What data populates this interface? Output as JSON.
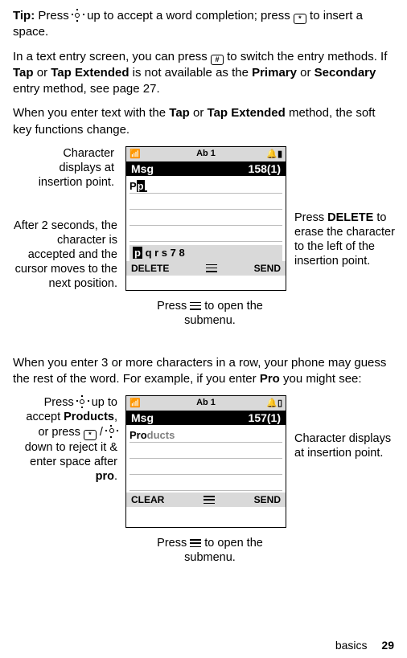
{
  "tip_label": "Tip:",
  "para1_a": "Press ",
  "para1_b": " up to accept a word completion; press ",
  "para1_c": " to insert a space.",
  "para2_a": "In a text entry screen, you can press ",
  "para2_b": " to switch the entry methods. If ",
  "tap": "Tap",
  "tap_ext": "Tap Extended",
  "para2_c": " is not available as the ",
  "primary": "Primary",
  "para2_d": " or ",
  "secondary": "Secondary",
  "para2_e": " entry method, see page 27.",
  "para3_a": "When you enter text with the ",
  "para3_b": " or ",
  "para3_c": " method, the soft key functions change.",
  "para4_a": "When you enter 3 or more characters in a row, your phone may guess the rest of the word. For example, if you enter ",
  "pro": "Pro",
  "para4_b": " you might see:",
  "fig1": {
    "status_mode": "Ab 1",
    "title": "Msg",
    "count": "158(1)",
    "typed": "P",
    "pending": "p",
    "candidates": "pq r s 7 8",
    "left_softkey": "DELETE",
    "right_softkey": "SEND",
    "callout_tl": "Character displays at insertion point.",
    "callout_bl": "After 2 seconds, the character is accepted and the cursor moves to the next position.",
    "callout_r_a": "Press ",
    "callout_r_b": "DELETE",
    "callout_r_c": " to erase the character to the left of the insertion point.",
    "callout_bottom_a": "Press ",
    "callout_bottom_b": " to open the submenu."
  },
  "fig2": {
    "status_mode": "Ab 1",
    "title": "Msg",
    "count": "157(1)",
    "typed": "Pro",
    "suggested": "ducts",
    "left_softkey": "CLEAR",
    "right_softkey": "SEND",
    "callout_l_a": "Press ",
    "callout_l_b": " up to accept ",
    "products": "Products",
    "callout_l_c": ", or press ",
    "callout_l_d": " / ",
    "callout_l_e": " down to reject it & enter space after ",
    "pro_lower": "pro",
    "callout_l_f": ".",
    "callout_r": "Character displays at insertion point.",
    "callout_bottom_a": "Press ",
    "callout_bottom_b": " to open the submenu."
  },
  "footer_section": "basics",
  "footer_page": "29"
}
